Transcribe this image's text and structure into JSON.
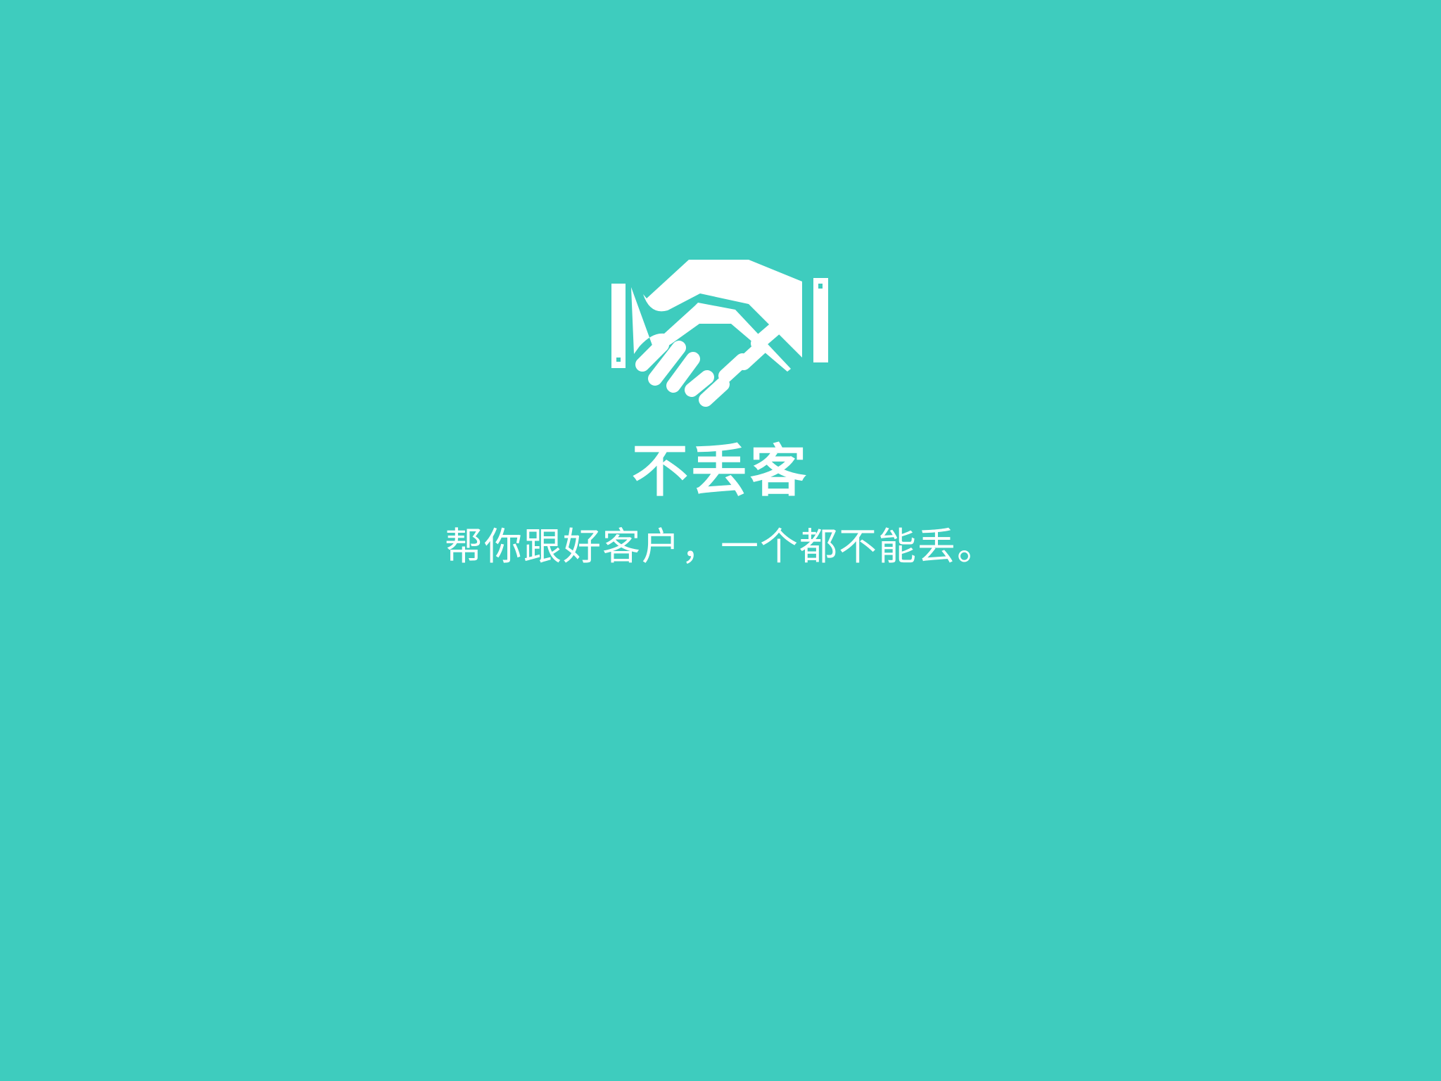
{
  "theme": {
    "background": "#3ECCBE",
    "foreground": "#FFFFFF"
  },
  "logo": {
    "icon": "handshake-icon"
  },
  "app": {
    "name": "不丢客",
    "tagline": "帮你跟好客户，一个都不能丢。"
  }
}
